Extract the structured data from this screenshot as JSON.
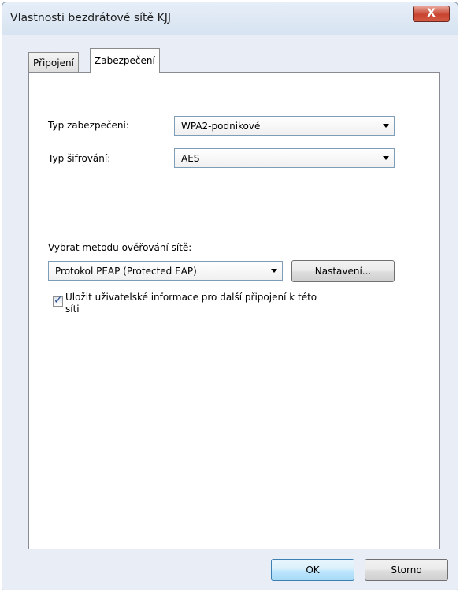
{
  "window": {
    "title": "Vlastnosti bezdrátové sítě KJJ",
    "close_label": "X"
  },
  "tabs": [
    {
      "label": "Připojení",
      "active": false
    },
    {
      "label": "Zabezpečení",
      "active": true
    }
  ],
  "security": {
    "type_label": "Typ zabezpečení:",
    "type_value": "WPA2-podnikové",
    "encryption_label": "Typ šifrování:",
    "encryption_value": "AES"
  },
  "auth": {
    "method_label": "Vybrat metodu ověřování sítě:",
    "method_value": "Protokol PEAP (Protected EAP)",
    "settings_button": "Nastavení...",
    "remember_label_line1": "Uložit uživatelské informace pro další připojení k této",
    "remember_label_line2": "síti",
    "remember_checked": true
  },
  "footer": {
    "ok_label": "OK",
    "cancel_label": "Storno"
  },
  "colors": {
    "close_button": "#c8432f",
    "focus_blue": "#3c7fb1",
    "window_bg": "#e9eef6"
  }
}
